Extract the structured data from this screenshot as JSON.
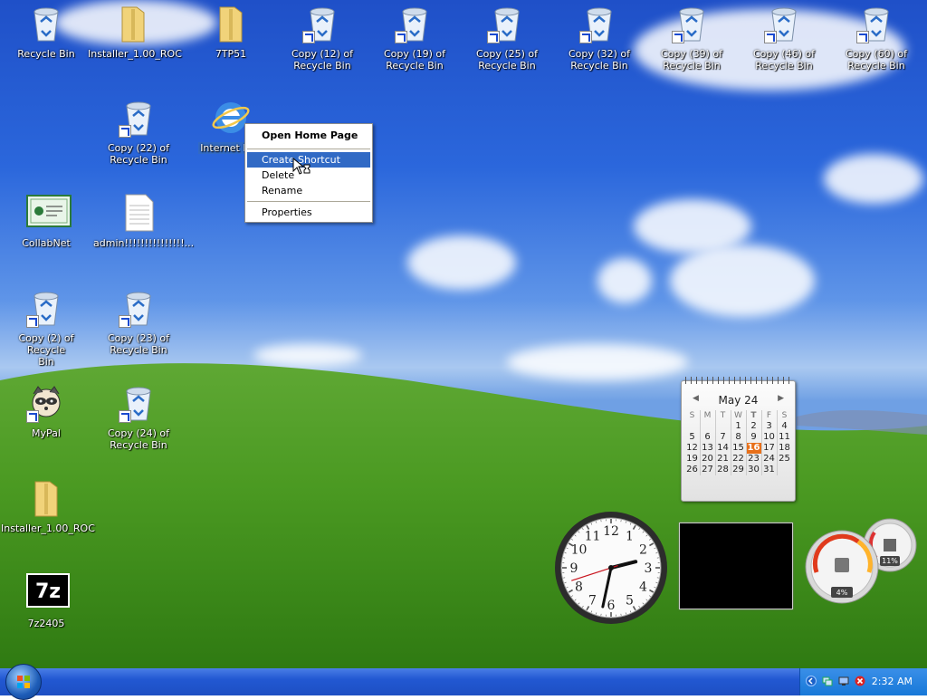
{
  "desktop_icons": [
    {
      "label": "Recycle Bin",
      "icon": "recycle-bin-icon"
    },
    {
      "label": "Installer_1.00_ROC",
      "icon": "folder-icon"
    },
    {
      "label": "7TP51",
      "icon": "folder-icon"
    },
    {
      "label": "Copy (12) of\nRecycle Bin",
      "icon": "recycle-bin-icon"
    },
    {
      "label": "Copy (19) of\nRecycle Bin",
      "icon": "recycle-bin-icon"
    },
    {
      "label": "Copy (25) of\nRecycle Bin",
      "icon": "recycle-bin-icon"
    },
    {
      "label": "Copy (32) of\nRecycle Bin",
      "icon": "recycle-bin-icon"
    },
    {
      "label": "Copy (39) of\nRecycle Bin",
      "icon": "recycle-bin-icon"
    },
    {
      "label": "Copy (46) of\nRecycle Bin",
      "icon": "recycle-bin-icon"
    },
    {
      "label": "Copy (60) of\nRecycle Bin",
      "icon": "recycle-bin-icon"
    },
    {
      "label": "Copy (22) of\nRecycle Bin",
      "icon": "recycle-bin-icon"
    },
    {
      "label": "Internet Exp",
      "icon": "internet-explorer-icon"
    },
    {
      "label": "CollabNet",
      "icon": "certificate-icon"
    },
    {
      "label": "admin!!!!!!!!!!!!!!!...",
      "icon": "text-file-icon"
    },
    {
      "label": "Copy (2) of Recycle\nBin",
      "icon": "recycle-bin-icon"
    },
    {
      "label": "Copy (23) of\nRecycle Bin",
      "icon": "recycle-bin-icon"
    },
    {
      "label": "MyPal",
      "icon": "raccoon-icon"
    },
    {
      "label": "Copy (24) of\nRecycle Bin",
      "icon": "recycle-bin-icon"
    },
    {
      "label": "Installer_1.00_ROC",
      "icon": "folder-icon"
    },
    {
      "label": "7z2405",
      "icon": "7zip-icon"
    }
  ],
  "context_menu": {
    "open_home_page": "Open Home Page",
    "create_shortcut": "Create Shortcut",
    "delete": "Delete",
    "rename": "Rename",
    "properties": "Properties"
  },
  "calendar": {
    "month": "May 24",
    "prev": "◀",
    "next": "▶",
    "weekdays": [
      "S",
      "M",
      "T",
      "W",
      "T",
      "F",
      "S"
    ],
    "weeks": [
      [
        "",
        "",
        "",
        "1",
        "2",
        "3",
        "4"
      ],
      [
        "5",
        "6",
        "7",
        "8",
        "9",
        "10",
        "11"
      ],
      [
        "12",
        "13",
        "14",
        "15",
        "16",
        "17",
        "18"
      ],
      [
        "19",
        "20",
        "21",
        "22",
        "23",
        "24",
        "25"
      ],
      [
        "26",
        "27",
        "28",
        "29",
        "30",
        "31",
        ""
      ]
    ],
    "today": "16"
  },
  "clock": {
    "numerals": [
      "12",
      "1",
      "2",
      "3",
      "4",
      "5",
      "6",
      "7",
      "8",
      "9",
      "10",
      "11"
    ],
    "hour": 2,
    "minute": 32,
    "second": 42
  },
  "meter": {
    "cpu": "4%",
    "memory": "11%"
  },
  "taskbar": {
    "time": "2:32 AM"
  },
  "colors": {
    "selection": "#316ac5",
    "taskbar": "#2258d2",
    "today": "#e8701a"
  }
}
